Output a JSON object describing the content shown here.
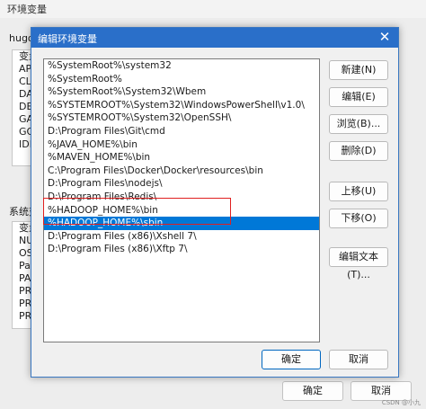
{
  "background_window": {
    "title": "环境变量",
    "user_section_label": "hugo",
    "user_list": [
      "变量",
      "AP",
      "CL",
      "DA",
      "DE",
      "GA",
      "GO",
      "IDI"
    ],
    "system_section_label": "系统变",
    "system_list": [
      "变量",
      "NU",
      "OS",
      "Pa",
      "PA",
      "PR",
      "PR",
      "PR"
    ],
    "ok_label": "确定",
    "cancel_label": "取消",
    "watermark": "CSDN @小九"
  },
  "dialog": {
    "title": "编辑环境变量",
    "close_glyph": "✕",
    "paths": [
      "%SystemRoot%\\system32",
      "%SystemRoot%",
      "%SystemRoot%\\System32\\Wbem",
      "%SYSTEMROOT%\\System32\\WindowsPowerShell\\v1.0\\",
      "%SYSTEMROOT%\\System32\\OpenSSH\\",
      "D:\\Program Files\\Git\\cmd",
      "%JAVA_HOME%\\bin",
      "%MAVEN_HOME%\\bin",
      "C:\\Program Files\\Docker\\Docker\\resources\\bin",
      "D:\\Program Files\\nodejs\\",
      "D:\\Program Files\\Redis\\",
      "%HADOOP_HOME%\\bin",
      "%HADOOP_HOME%\\sbin",
      "D:\\Program Files (x86)\\Xshell 7\\",
      "D:\\Program Files (x86)\\Xftp 7\\"
    ],
    "selected_index": 12,
    "buttons": {
      "new": "新建(N)",
      "edit": "编辑(E)",
      "browse": "浏览(B)...",
      "delete": "删除(D)",
      "move_up": "上移(U)",
      "move_down": "下移(O)",
      "edit_text": "编辑文本(T)...",
      "ok": "确定",
      "cancel": "取消"
    }
  }
}
